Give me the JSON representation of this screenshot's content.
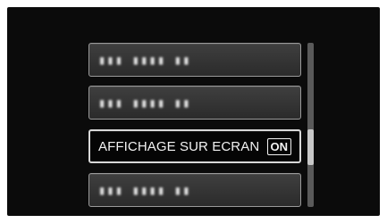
{
  "menu": {
    "items": [
      {
        "label": "▮▮▮ ▮▮▮▮ ▮▮",
        "state": "obscured",
        "selected": false
      },
      {
        "label": "▮▮▮ ▮▮▮▮ ▮▮",
        "state": "obscured",
        "selected": false
      },
      {
        "label": "AFFICHAGE SUR ECRAN",
        "value": "ON",
        "selected": true
      },
      {
        "label": "▮▮▮ ▮▮▮▮ ▮▮",
        "state": "obscured",
        "selected": false
      }
    ]
  },
  "scroll": {
    "position_fraction": 0.6,
    "visible_fraction": 0.22
  },
  "colors": {
    "screen_background": "#0b0b0b",
    "item_background": "#333333",
    "selected_background": "#050505",
    "text": "#f2f2f2"
  }
}
